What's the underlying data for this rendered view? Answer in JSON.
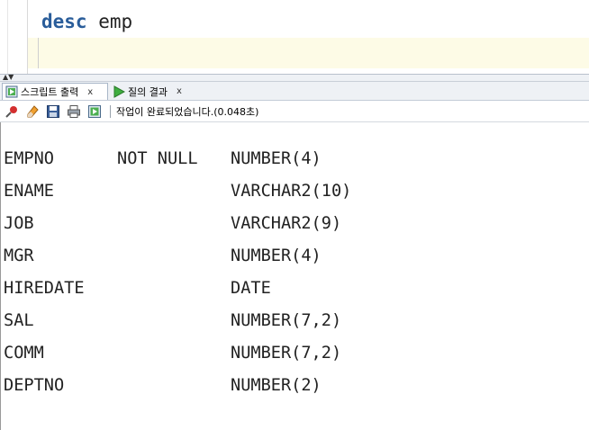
{
  "editor": {
    "keyword": "desc",
    "argument": " emp"
  },
  "tabs": [
    {
      "label": "스크립트 출력",
      "close": "x",
      "active": true
    },
    {
      "label": "질의 결과",
      "close": "x",
      "active": false
    }
  ],
  "toolbar": {
    "icons": [
      "pin-icon",
      "eraser-icon",
      "save-icon",
      "print-icon",
      "script-icon"
    ],
    "status": "작업이 완료되었습니다.(0.048초)"
  },
  "output": {
    "divider": "--------- -------- ------------",
    "rows": [
      {
        "name": "EMPNO",
        "null": "NOT NULL",
        "type": "NUMBER(4)"
      },
      {
        "name": "ENAME",
        "null": "",
        "type": "VARCHAR2(10)"
      },
      {
        "name": "JOB",
        "null": "",
        "type": "VARCHAR2(9)"
      },
      {
        "name": "MGR",
        "null": "",
        "type": "NUMBER(4)"
      },
      {
        "name": "HIREDATE",
        "null": "",
        "type": "DATE"
      },
      {
        "name": "SAL",
        "null": "",
        "type": "NUMBER(7,2)"
      },
      {
        "name": "COMM",
        "null": "",
        "type": "NUMBER(7,2)"
      },
      {
        "name": "DEPTNO",
        "null": "",
        "type": "NUMBER(2)"
      }
    ]
  }
}
